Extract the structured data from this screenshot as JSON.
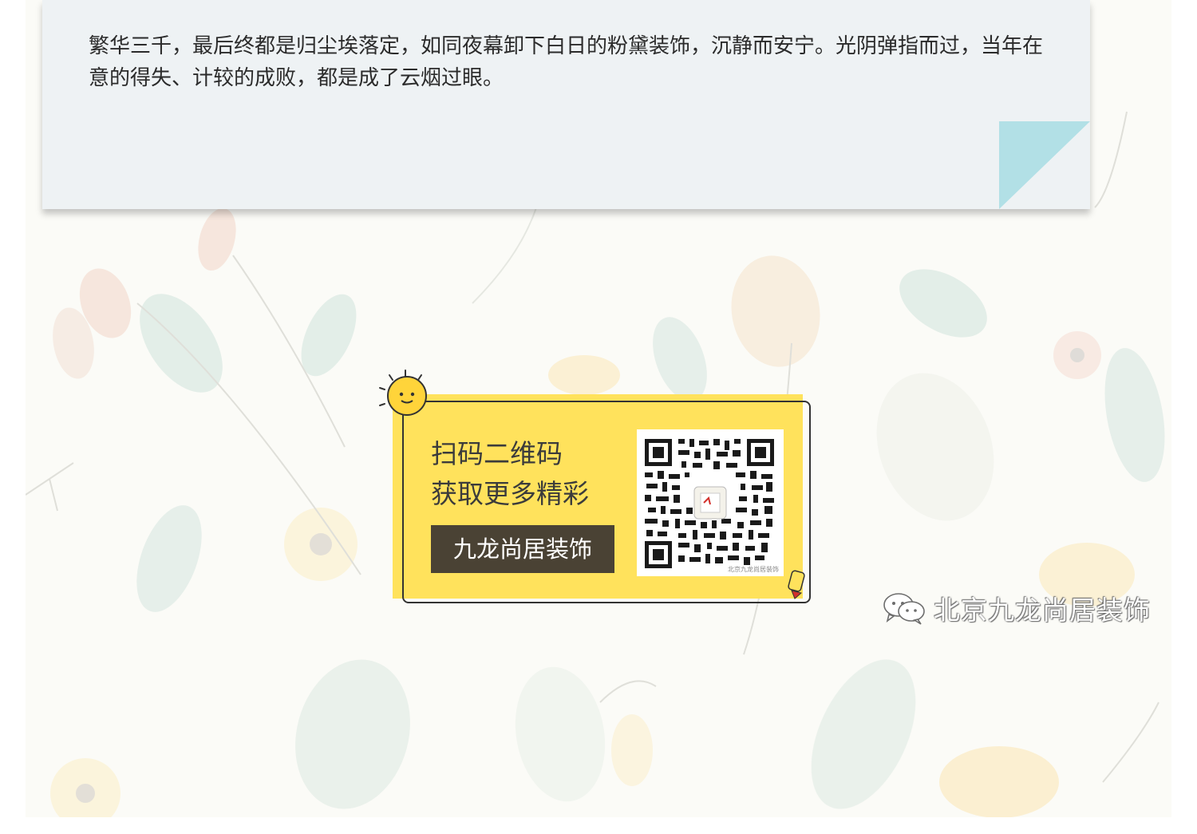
{
  "article": {
    "paragraph": "繁华三千，最后终都是归尘埃落定，如同夜幕卸下白日的粉黛装饰，沉静而安宁。光阴弹指而过，当年在意的得失、计较的成败，都是成了云烟过眼。"
  },
  "promo": {
    "line1": "扫码二维码",
    "line2": "获取更多精彩",
    "brand_button": "九龙尚居装饰",
    "qr_caption": "北京九龙尚居装饰",
    "qr_icon": "qr-code-icon",
    "sun_icon": "sun-face-icon",
    "pencil_icon": "pencil-icon"
  },
  "watermark": {
    "icon": "wechat-icon",
    "text": "北京九龙尚居装饰"
  },
  "colors": {
    "card_bg": "#eef2f4",
    "fold": "#b2e0e6",
    "promo_yellow": "#ffe25c",
    "button_bg": "#4a4234"
  }
}
